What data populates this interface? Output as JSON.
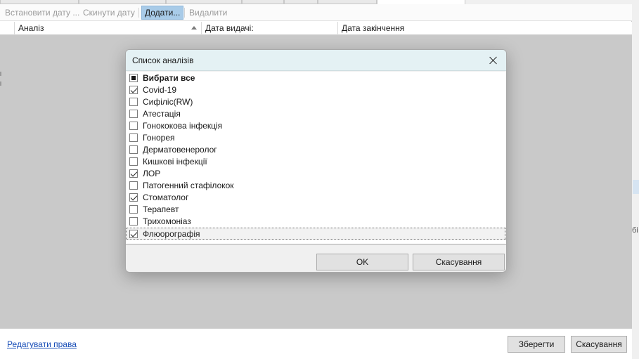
{
  "toolbar": {
    "set_date": "Встановити дату ...",
    "reset_date": "Скинути дату",
    "add": "Додати...",
    "delete": "Видалити"
  },
  "grid": {
    "columns": [
      "Аналіз",
      "Дата видачі:",
      "Дата закінчення"
    ]
  },
  "footer": {
    "edit_rights": "Редагувати права",
    "save": "Зберегти",
    "cancel": "Скасування"
  },
  "edge": {
    "fragment": "бі"
  },
  "dialog": {
    "title": "Список аналізів",
    "items": [
      {
        "label": "Вибрати все",
        "state": "partial",
        "bold": true
      },
      {
        "label": "Covid-19",
        "state": "checked"
      },
      {
        "label": "Сифіліс(RW)",
        "state": "unchecked"
      },
      {
        "label": "Атестація",
        "state": "unchecked"
      },
      {
        "label": "Гонококова інфекція",
        "state": "unchecked"
      },
      {
        "label": "Гонорея",
        "state": "unchecked"
      },
      {
        "label": "Дерматовенеролог",
        "state": "unchecked"
      },
      {
        "label": "Кишкові інфекції",
        "state": "unchecked"
      },
      {
        "label": "ЛОР",
        "state": "checked"
      },
      {
        "label": "Патогенний стафілокок",
        "state": "unchecked"
      },
      {
        "label": "Стоматолог",
        "state": "checked"
      },
      {
        "label": "Терапевт",
        "state": "unchecked"
      },
      {
        "label": "Трихомоніаз",
        "state": "unchecked"
      },
      {
        "label": "Флюорографія",
        "state": "checked",
        "focused": true
      }
    ],
    "ok": "OK",
    "cancel": "Скасування"
  }
}
